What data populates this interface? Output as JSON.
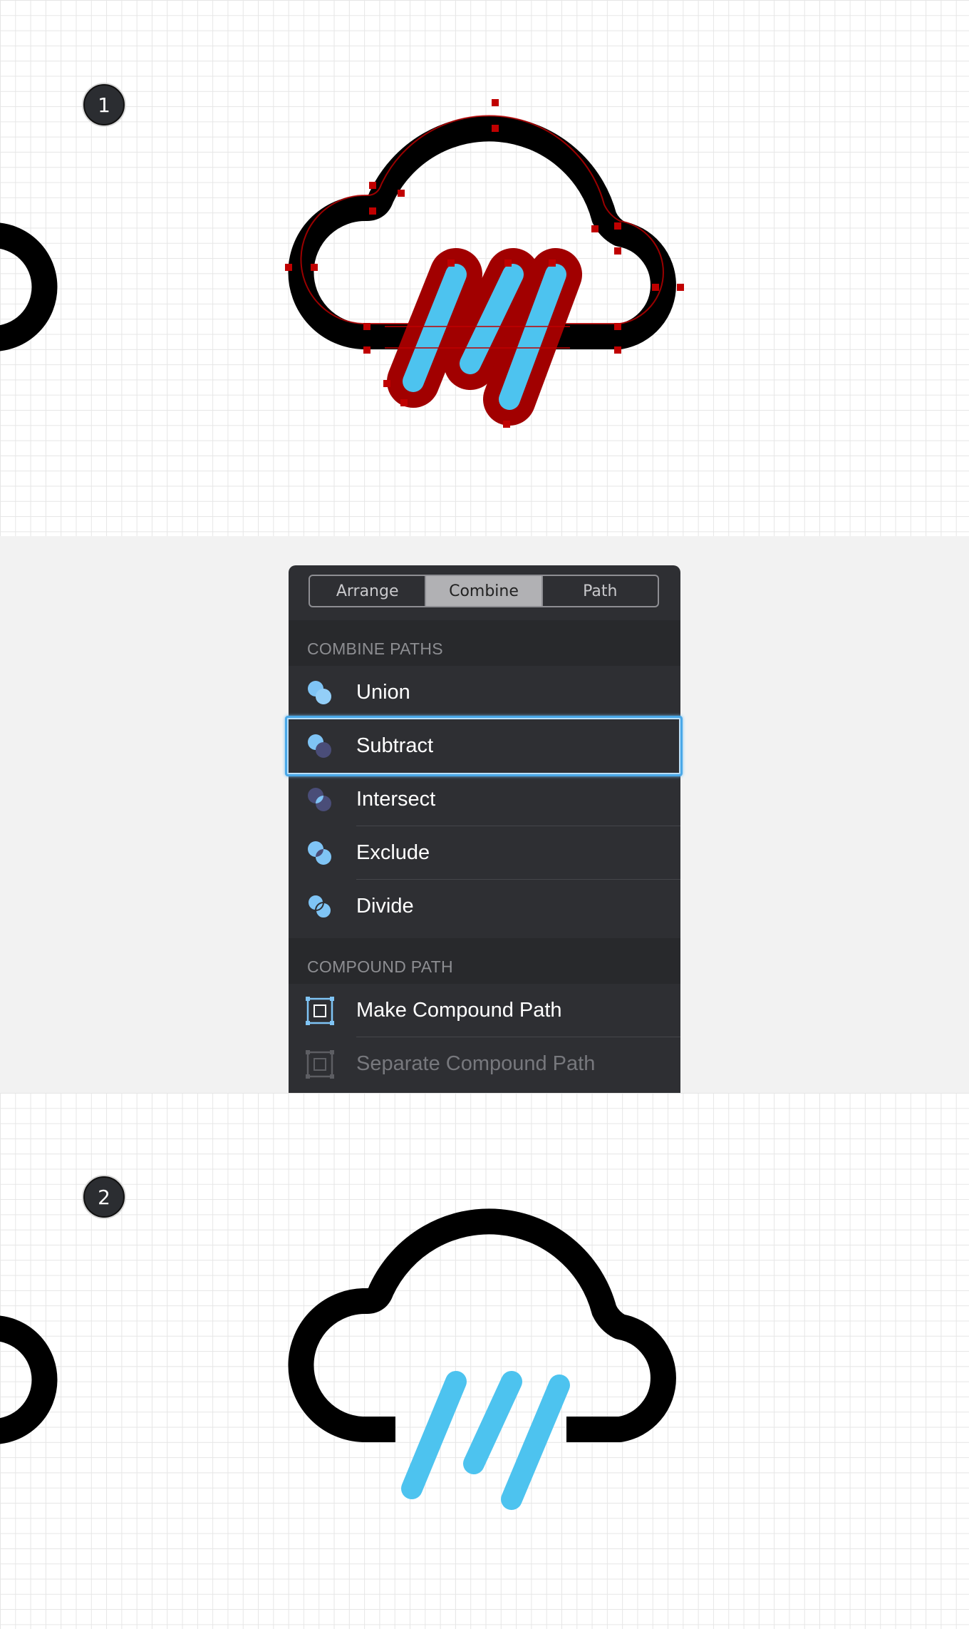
{
  "steps": {
    "step1_label": "1",
    "step2_label": "2"
  },
  "menu": {
    "tabs": [
      {
        "label": "Arrange",
        "active": false
      },
      {
        "label": "Combine",
        "active": true
      },
      {
        "label": "Path",
        "active": false
      }
    ],
    "combine_paths_header": "COMBINE PATHS",
    "combine_items": [
      {
        "label": "Union",
        "icon": "union-icon",
        "selected": false
      },
      {
        "label": "Subtract",
        "icon": "subtract-icon",
        "selected": true
      },
      {
        "label": "Intersect",
        "icon": "intersect-icon",
        "selected": false
      },
      {
        "label": "Exclude",
        "icon": "exclude-icon",
        "selected": false
      },
      {
        "label": "Divide",
        "icon": "divide-icon",
        "selected": false
      }
    ],
    "compound_path_header": "COMPOUND PATH",
    "compound_items": [
      {
        "label": "Make Compound Path",
        "icon": "compound-path-icon",
        "enabled": true
      },
      {
        "label": "Separate Compound Path",
        "icon": "separate-path-icon",
        "enabled": false
      }
    ]
  },
  "colors": {
    "rain_blue": "#4dc3ef",
    "selection_red": "#c00000",
    "menu_background": "#2e2f33",
    "selection_highlight": "#4aa8e8",
    "icon_blue": "#7fc4f5"
  }
}
